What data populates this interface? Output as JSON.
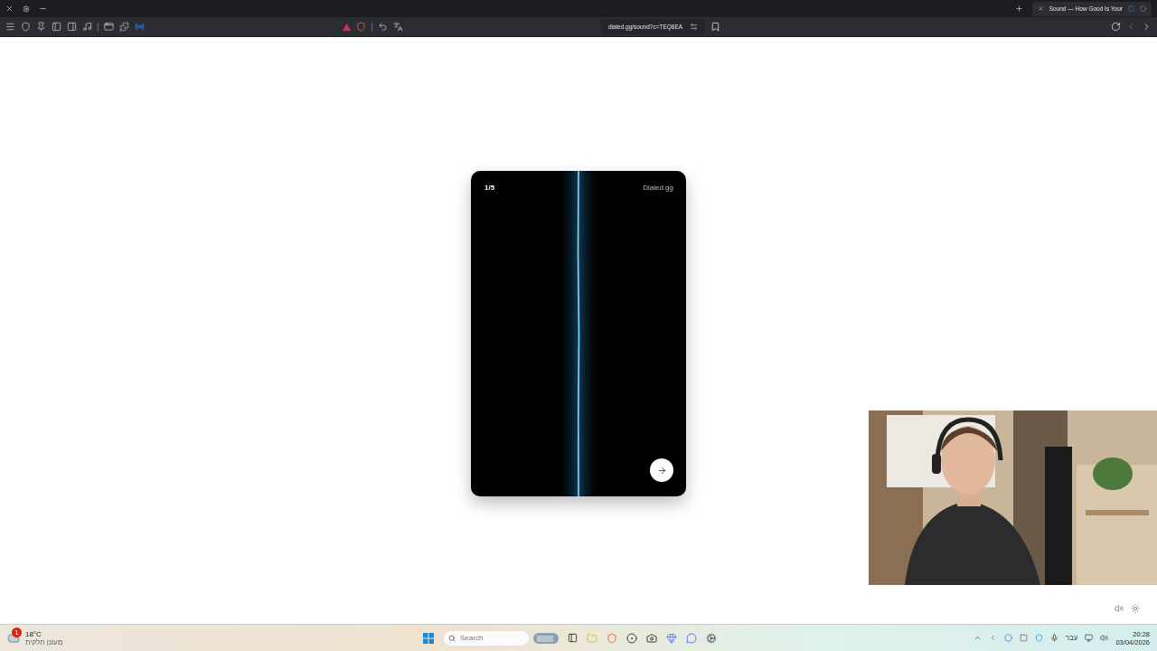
{
  "browser": {
    "tab": {
      "title": "Sound — How Good Is Your",
      "selected": true
    },
    "address": "dialed.gg/sound?c=TEQ8EA"
  },
  "card": {
    "counter": "1/5",
    "brand": "Dialed.gg"
  },
  "taskbar": {
    "weather": {
      "temperature": "18°C",
      "condition": "מעונן חלקית",
      "alerts": "1"
    },
    "search": {
      "placeholder": "Search"
    },
    "language": "עבר",
    "time": "20:28",
    "date": "03/04/2026"
  }
}
